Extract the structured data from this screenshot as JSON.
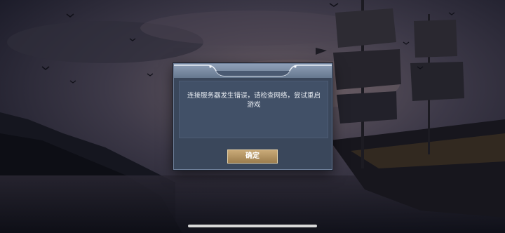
{
  "dialog": {
    "message": "连接服务器发生错误，请检查网络，尝试重启游戏",
    "ok_label": "确定"
  }
}
